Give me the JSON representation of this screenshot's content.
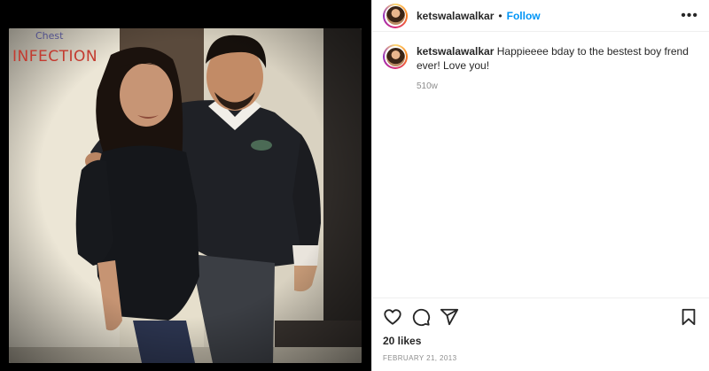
{
  "post": {
    "username": "ketswalawalkar",
    "follow_label": "Follow",
    "separator": "•",
    "more_icon": "more-horizontal-icon",
    "caption": {
      "username": "ketswalawalkar",
      "text": "Happieeee bday to the bestest boy frend ever! Love you!",
      "age": "510w"
    },
    "likes": "20 likes",
    "date": "FEBRUARY 21, 2013",
    "actions": [
      "heart-icon",
      "comment-icon",
      "share-icon",
      "bookmark-icon"
    ],
    "photo": {
      "sign_line_1": "Chest",
      "sign_line_2": "INFECTION"
    }
  },
  "colors": {
    "follow": "#0095f6",
    "meta": "#8e8e8e",
    "text": "#262626",
    "media_bg": "#000000"
  }
}
